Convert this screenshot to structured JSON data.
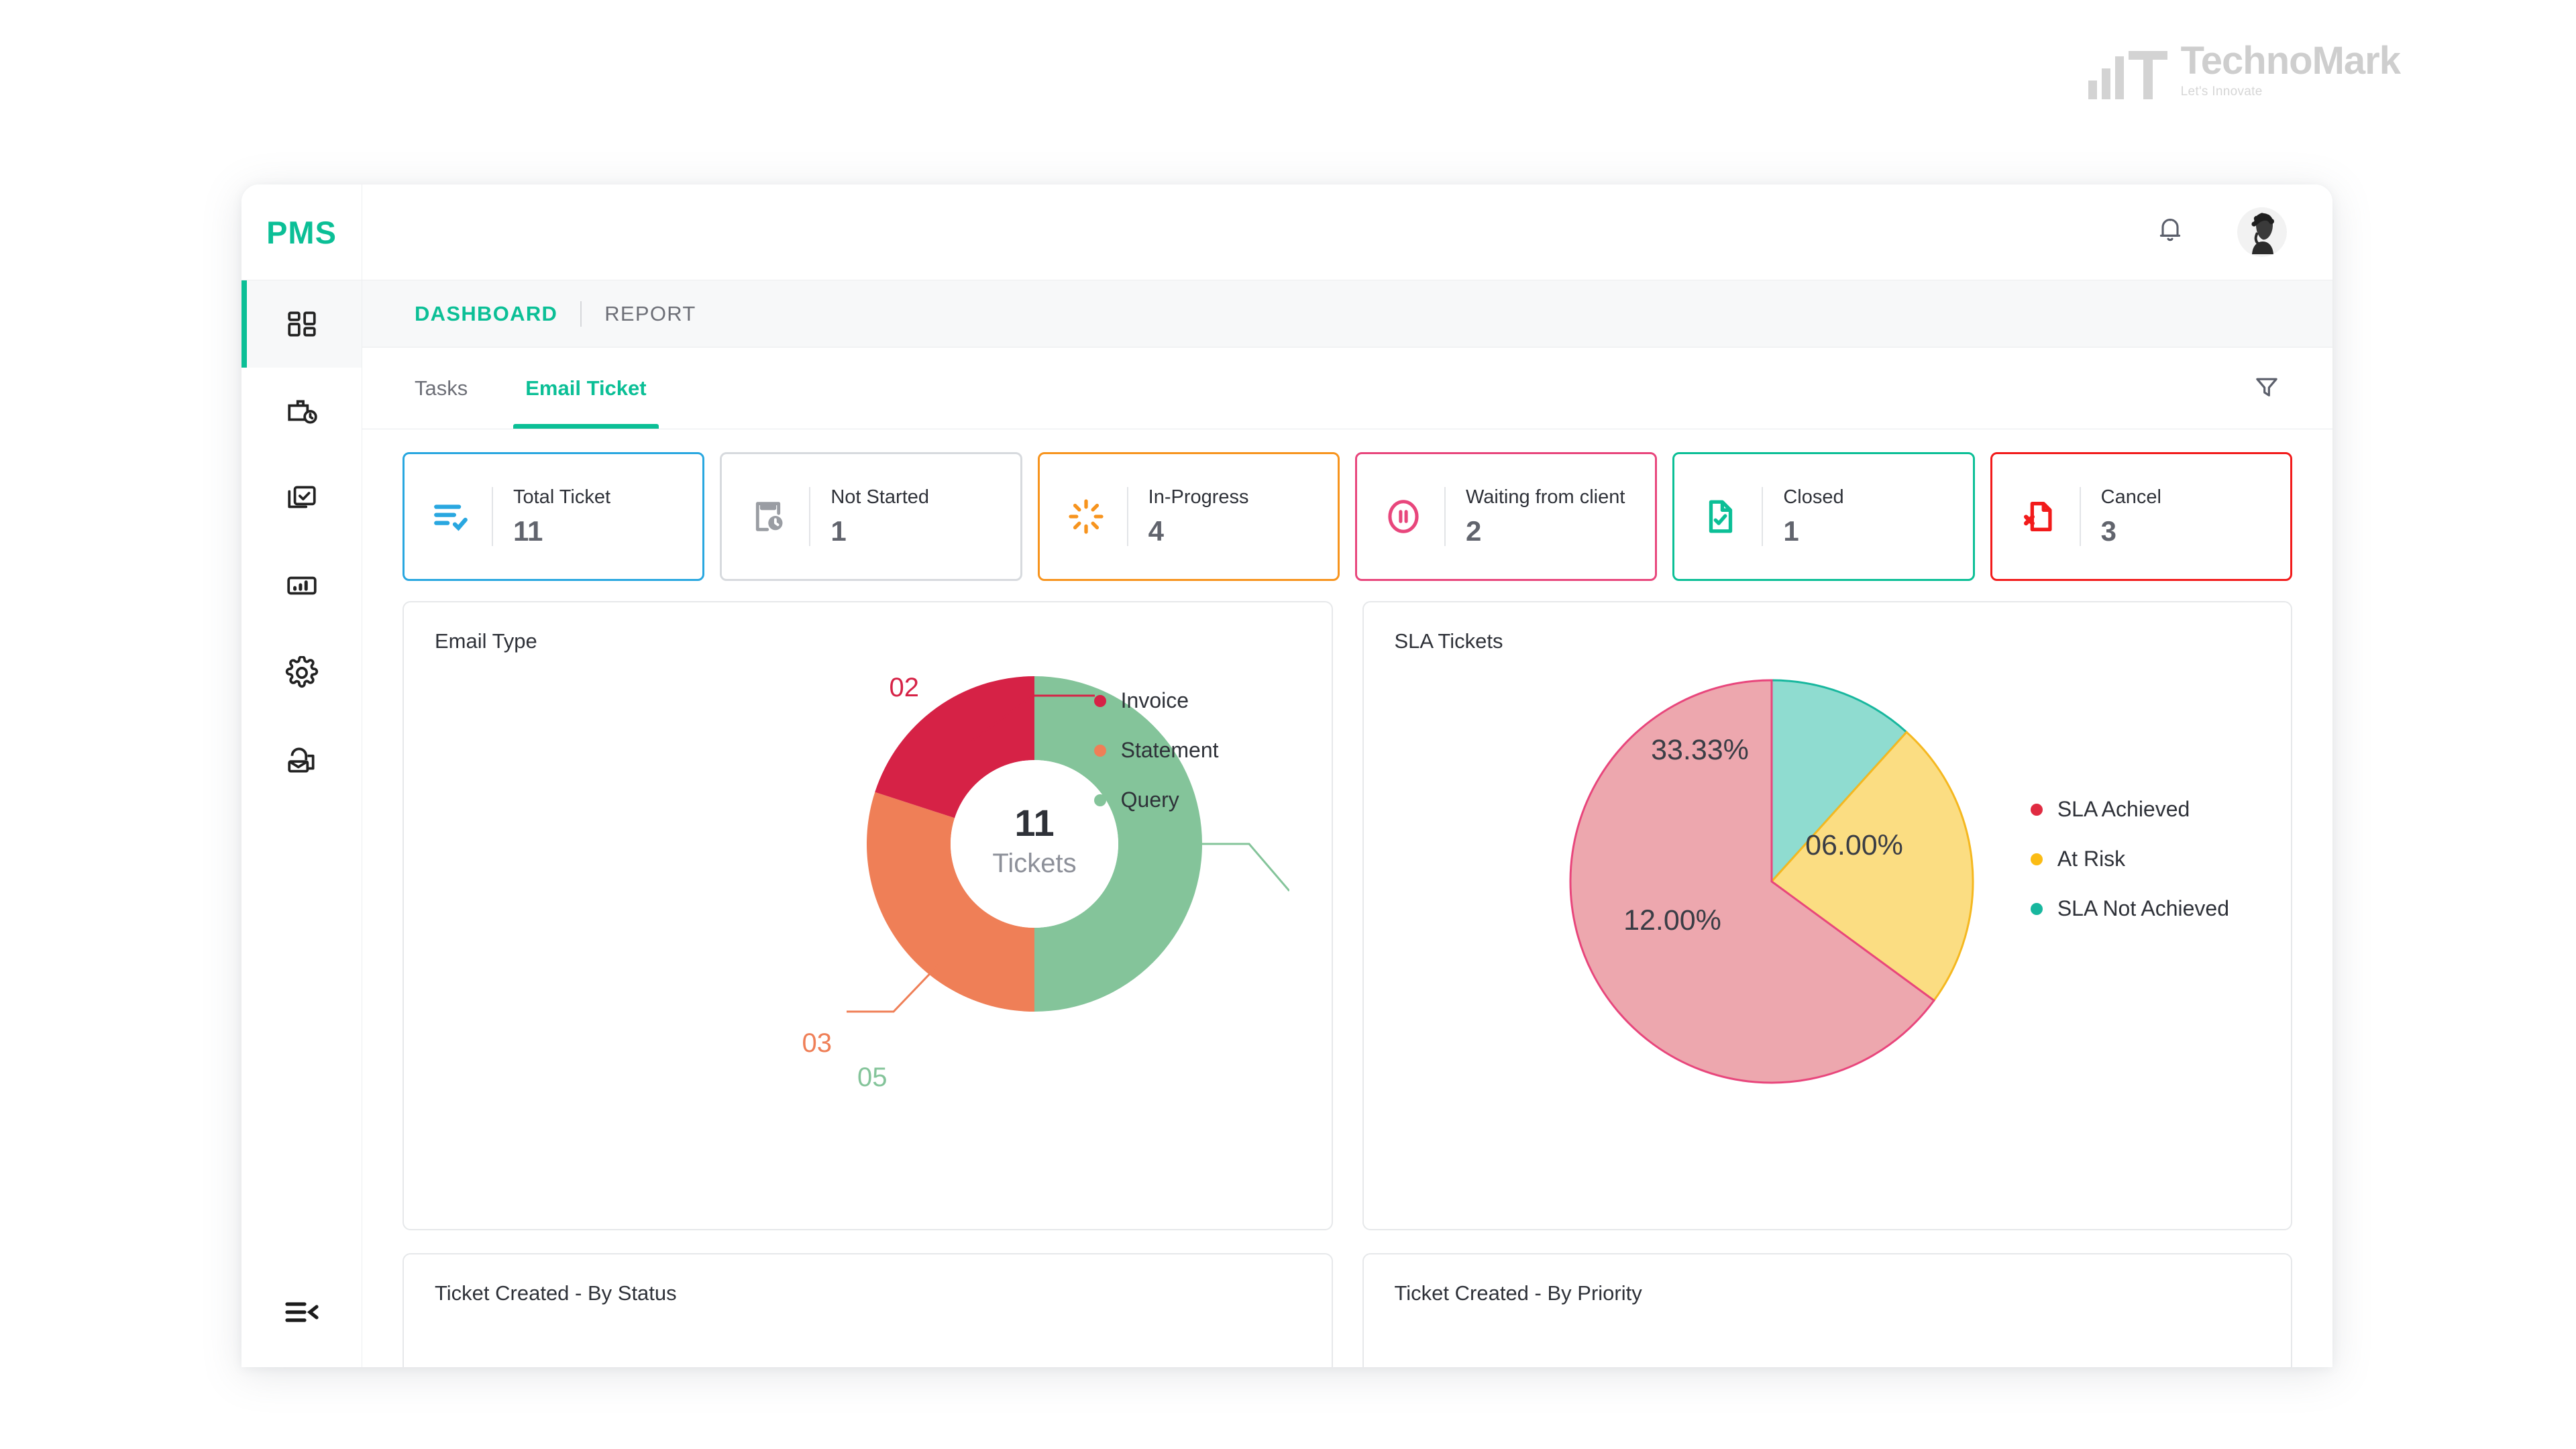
{
  "brand": {
    "name": "TechnoMark",
    "tagline": "Let's Innovate"
  },
  "sidebar": {
    "logo": "PMS",
    "items": [
      {
        "icon": "dashboard-grid-icon",
        "name": "dashboard",
        "active": true
      },
      {
        "icon": "briefcase-clock-icon",
        "name": "timesheet",
        "active": false
      },
      {
        "icon": "layers-check-icon",
        "name": "tasks",
        "active": false
      },
      {
        "icon": "bar-chart-icon",
        "name": "reports",
        "active": false
      },
      {
        "icon": "gear-icon",
        "name": "settings",
        "active": false
      },
      {
        "icon": "inbox-mail-icon",
        "name": "mailbox",
        "active": false
      }
    ],
    "collapse_icon": "collapse-menu-icon"
  },
  "topbar": {
    "bell_icon": "bell-icon",
    "avatar_icon": "user-avatar"
  },
  "breadcrumb": {
    "active": "DASHBOARD",
    "separator": "|",
    "inactive": "REPORT"
  },
  "tabs": [
    {
      "label": "Tasks",
      "active": false
    },
    {
      "label": "Email Ticket",
      "active": true
    }
  ],
  "filter_icon": "filter-funnel-icon",
  "stat_cards": [
    {
      "label": "Total Ticket",
      "value": "11",
      "color": "#29a7e0",
      "icon": "list-check-icon"
    },
    {
      "label": "Not Started",
      "value": "1",
      "color": "#9a9da3",
      "icon": "clipboard-clock-icon"
    },
    {
      "label": "In-Progress",
      "value": "4",
      "color": "#f7941e",
      "icon": "spinner-icon"
    },
    {
      "label": "Waiting from client",
      "value": "2",
      "color": "#e8467c",
      "icon": "pause-circle-icon"
    },
    {
      "label": "Closed",
      "value": "1",
      "color": "#0bbf96",
      "icon": "file-check-icon"
    },
    {
      "label": "Cancel",
      "value": "3",
      "color": "#f21b1b",
      "icon": "file-x-icon"
    }
  ],
  "panels": {
    "email_type": {
      "title": "Email Type"
    },
    "sla_tickets": {
      "title": "SLA Tickets"
    },
    "ticket_by_status": {
      "title": "Ticket Created - By Status"
    },
    "ticket_by_priority": {
      "title": "Ticket Created - By Priority"
    }
  },
  "chart_data": [
    {
      "type": "pie",
      "title": "Email Type",
      "variant": "donut",
      "center_value": "11",
      "center_label": "Tickets",
      "categories": [
        "Invoice",
        "Statement",
        "Query"
      ],
      "values": [
        2,
        3,
        5
      ],
      "labels": [
        "02",
        "03",
        "05"
      ],
      "colors": [
        "#d62246",
        "#ef7f57",
        "#84c49a"
      ],
      "legend_position": "right",
      "legend": [
        "Invoice",
        "Statement",
        "Query"
      ]
    },
    {
      "type": "pie",
      "title": "SLA Tickets",
      "categories": [
        "SLA Achieved",
        "At Risk",
        "SLA Not Achieved"
      ],
      "values": [
        33.33,
        12.0,
        6.0
      ],
      "labels": [
        "33.33%",
        "12.00%",
        "06.00%"
      ],
      "colors": [
        "#eda7ae",
        "#fbdd82",
        "#8fdcd0"
      ],
      "stroke_colors": [
        "#e8467c",
        "#f5b820",
        "#18b79e"
      ],
      "legend_position": "right",
      "legend": [
        "SLA Achieved",
        "At Risk",
        "SLA Not Achieved"
      ],
      "legend_colors": [
        "#e02b41",
        "#fbbc14",
        "#17b79e"
      ]
    }
  ]
}
